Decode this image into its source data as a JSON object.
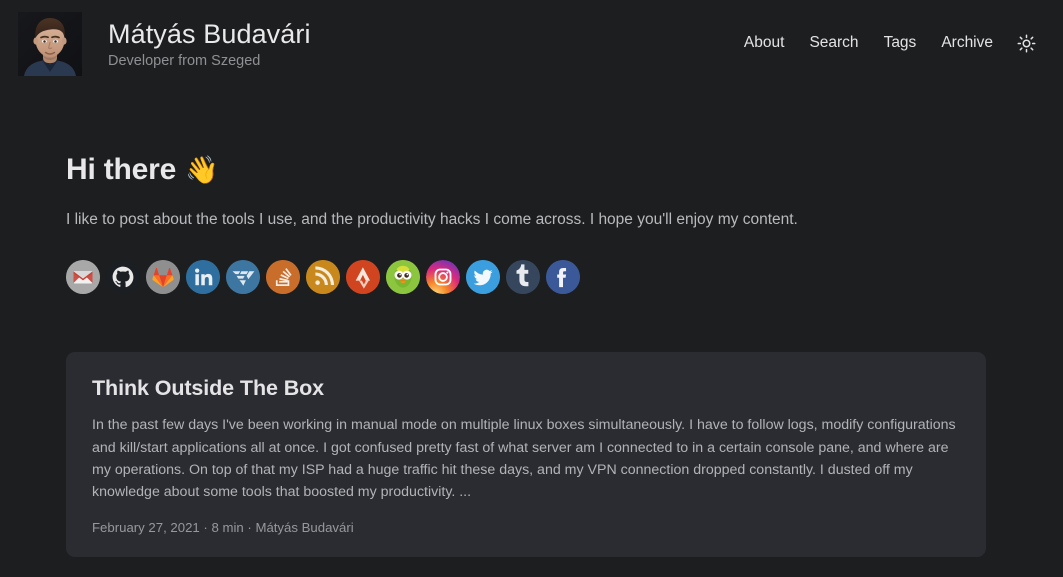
{
  "header": {
    "avatar_alt": "Mátyás Budavári",
    "title": "Mátyás Budavári",
    "subtitle": "Developer from Szeged",
    "nav": [
      {
        "label": "About"
      },
      {
        "label": "Search"
      },
      {
        "label": "Tags"
      },
      {
        "label": "Archive"
      }
    ],
    "theme_toggle_icon": "sun-icon"
  },
  "hero": {
    "title": "Hi there",
    "emoji": "👋",
    "description": "I like to post about the tools I use, and the productivity hacks I come across. I hope you'll enjoy my content."
  },
  "socials": [
    {
      "name": "gmail",
      "label": "Gmail",
      "color": "#9e9e9e"
    },
    {
      "name": "github",
      "label": "GitHub",
      "color": "#1b1f23"
    },
    {
      "name": "gitlab",
      "label": "GitLab",
      "color": "#8c8c8c"
    },
    {
      "name": "linkedin",
      "label": "LinkedIn",
      "color": "#2f6f9f"
    },
    {
      "name": "freelancer",
      "label": "Freelancer",
      "color": "#3c76a1"
    },
    {
      "name": "stackoverflow",
      "label": "Stack Overflow",
      "color": "#c96d2a"
    },
    {
      "name": "rss",
      "label": "RSS",
      "color": "#c8881c"
    },
    {
      "name": "strava",
      "label": "Strava",
      "color": "#d0451f"
    },
    {
      "name": "duolingo",
      "label": "Duolingo",
      "color": "#8fc63d"
    },
    {
      "name": "instagram",
      "label": "Instagram",
      "color": "#c13584"
    },
    {
      "name": "twitter",
      "label": "Twitter",
      "color": "#3b9ede"
    },
    {
      "name": "tumblr",
      "label": "Tumblr",
      "color": "#36465d"
    },
    {
      "name": "facebook",
      "label": "Facebook",
      "color": "#3b5998"
    }
  ],
  "posts": [
    {
      "title": "Think Outside The Box",
      "summary": "In the past few days I've been working in manual mode on multiple linux boxes simultaneously. I have to follow logs, modify configurations and kill/start applications all at once. I got confused pretty fast of what server am I connected to in a certain console pane, and where are my operations. On top of that my ISP had a huge traffic hit these days, and my VPN connection dropped constantly. I dusted off my knowledge about some tools that boosted my productivity. ...",
      "date": "February 27, 2021",
      "reading_time": "8 min",
      "author": "Mátyás Budavári",
      "meta": "February 27, 2021 · 8 min · Mátyás Budavári"
    }
  ],
  "theme": {
    "background": "#1d1e20",
    "card_background": "#2b2c31",
    "text_primary": "#e4e4e6",
    "text_secondary": "#b2b3b7",
    "text_muted": "#97989c"
  }
}
